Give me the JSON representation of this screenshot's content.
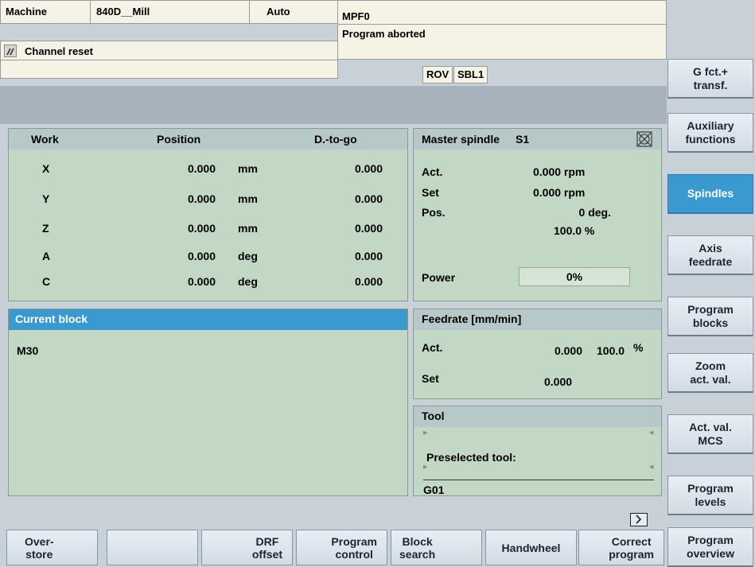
{
  "header": {
    "machine_label": "Machine",
    "machine_value": "840D__Mill",
    "mode": "Auto",
    "program": "MPF0",
    "channel_status": "Channel reset",
    "program_status": "Program aborted",
    "tags": [
      "ROV",
      "SBL1"
    ]
  },
  "work_panel": {
    "col_work": "Work",
    "col_position": "Position",
    "col_dtogo": "D.-to-go",
    "rows": [
      {
        "axis": "X",
        "pos": "0.000",
        "unit": "mm",
        "dtg": "0.000"
      },
      {
        "axis": "Y",
        "pos": "0.000",
        "unit": "mm",
        "dtg": "0.000"
      },
      {
        "axis": "Z",
        "pos": "0.000",
        "unit": "mm",
        "dtg": "0.000"
      },
      {
        "axis": "A",
        "pos": "0.000",
        "unit": "deg",
        "dtg": "0.000"
      },
      {
        "axis": "C",
        "pos": "0.000",
        "unit": "deg",
        "dtg": "0.000"
      }
    ]
  },
  "spindle": {
    "title": "Master spindle",
    "id": "S1",
    "act_label": "Act.",
    "act_value": "0.000 rpm",
    "set_label": "Set",
    "set_value": "0.000 rpm",
    "pos_label": "Pos.",
    "pos_value": "0 deg.",
    "override": "100.0 %",
    "power_label": "Power",
    "power_value": "0%"
  },
  "current_block": {
    "title": "Current block",
    "line": "M30"
  },
  "feedrate": {
    "title": "Feedrate [mm/min]",
    "act_label": "Act.",
    "act_value": "0.000",
    "override": "100.0",
    "override_unit": "%",
    "set_label": "Set",
    "set_value": "0.000"
  },
  "tool": {
    "title": "Tool",
    "preselected_label": "Preselected tool:",
    "gcode": "G01"
  },
  "right_softkeys": [
    {
      "label": "G fct.+\ntransf.",
      "active": false
    },
    {
      "label": "Auxiliary\nfunctions",
      "active": false
    },
    {
      "label": "Spindles",
      "active": true
    },
    {
      "label": "Axis\nfeedrate",
      "active": false
    },
    {
      "label": "Program\nblocks",
      "active": false
    },
    {
      "label": "Zoom\nact. val.",
      "active": false
    },
    {
      "label": "Act. val.\nMCS",
      "active": false
    },
    {
      "label": "Program\nlevels",
      "active": false
    },
    {
      "label": "Program\noverview",
      "active": false
    }
  ],
  "bottom_softkeys": [
    {
      "label": "Over-\nstore"
    },
    {
      "label": ""
    },
    {
      "label": "DRF\noffset"
    },
    {
      "label": "Program\ncontrol"
    },
    {
      "label": "Block\nsearch"
    },
    {
      "label": "Handwheel"
    },
    {
      "label": "Correct\nprogram"
    }
  ],
  "colors": {
    "panel_green": "#c2d8c4",
    "accent_blue": "#3a9ad0",
    "header_cream": "#f5f2e6"
  },
  "icons": [
    "channel-reset-icon",
    "spindle-stopped-icon",
    "next-arrow-icon"
  ]
}
